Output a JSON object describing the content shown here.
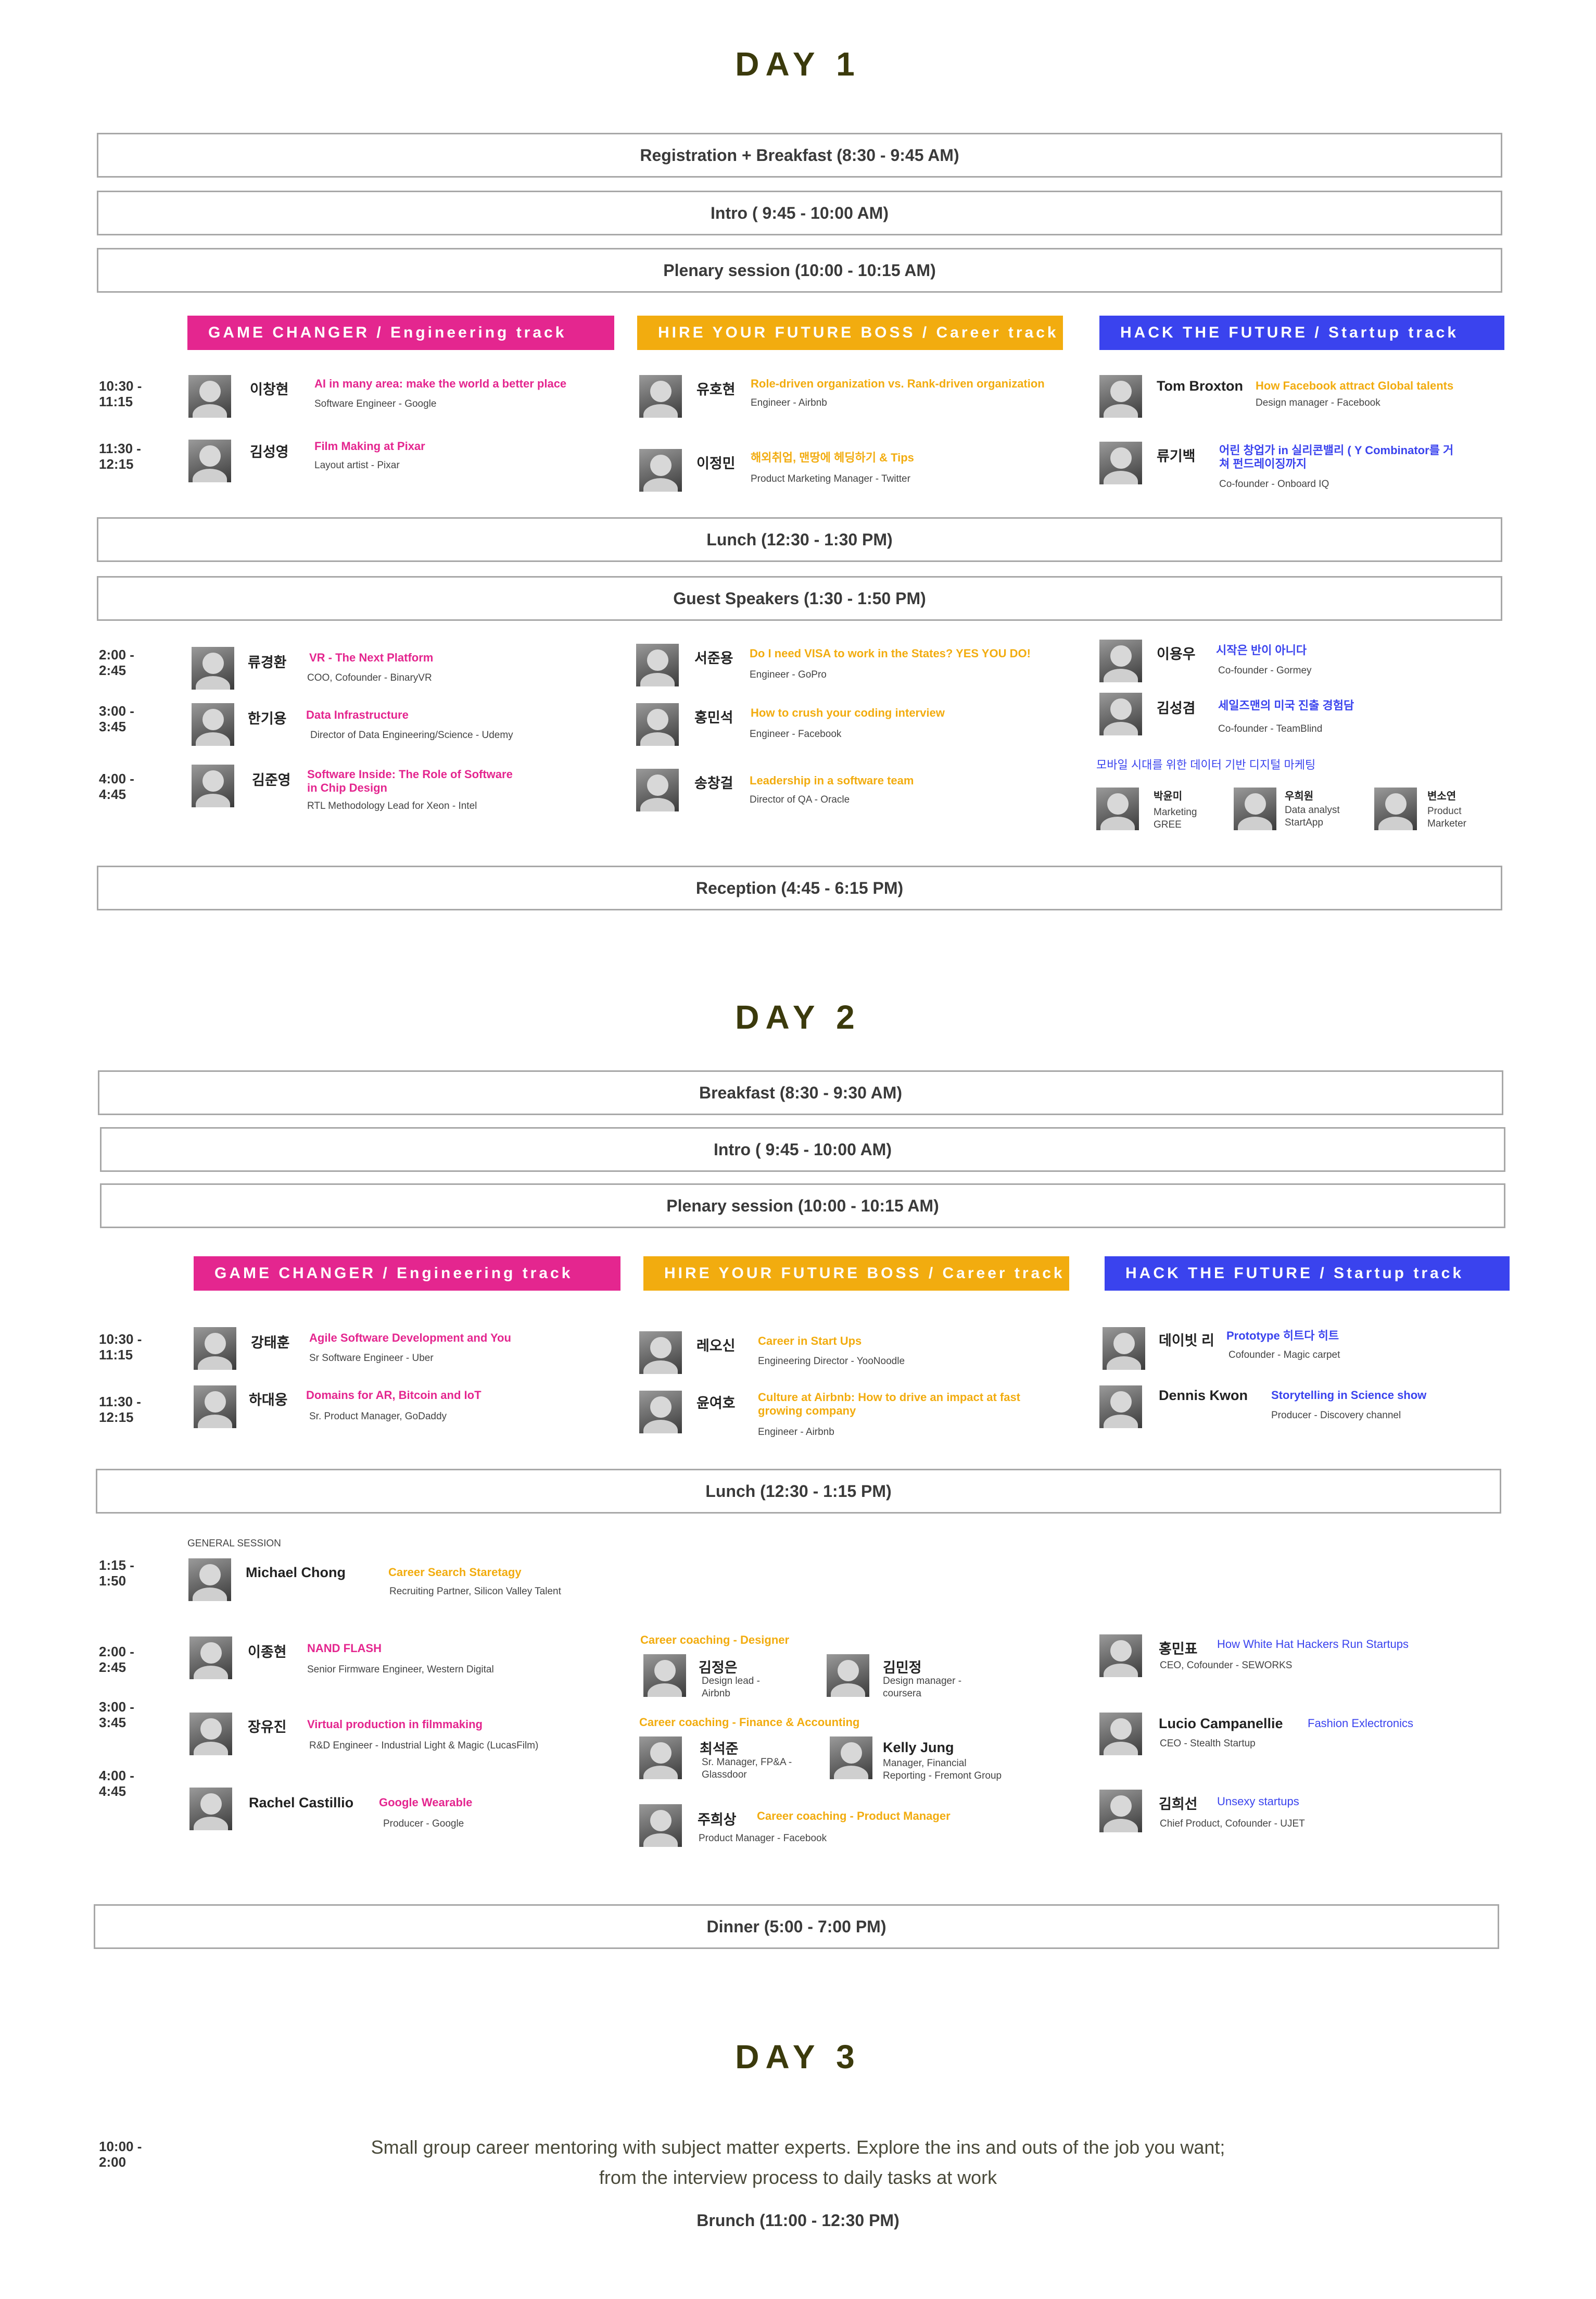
{
  "colors": {
    "engineering": "#e4268f",
    "career": "#f2ac0f",
    "startup": "#3a43ee",
    "title": "#3b3a0c",
    "border": "#a8a8a8"
  },
  "day1": {
    "title": "DAY 1",
    "registration": "Registration + Breakfast (8:30 - 9:45 AM)",
    "intro": "Intro ( 9:45 - 10:00 AM)",
    "plenary": "Plenary session (10:00 - 10:15 AM)",
    "tracks": [
      "GAME CHANGER / Engineering track",
      "HIRE YOUR FUTURE BOSS / Career track",
      "HACK THE FUTURE / Startup track"
    ],
    "times": {
      "t1": "10:30 -\n11:15",
      "t2": "11:30 -\n12:15",
      "t3": "2:00 -\n2:45",
      "t4": "3:00 -\n3:45",
      "t5": "4:00 -\n4:45"
    },
    "morning": [
      {
        "name": "이창현",
        "title": "AI in many area: make the world a better place",
        "role": "Software Engineer  - Google"
      },
      {
        "name": "김성영",
        "title": "Film Making at Pixar",
        "role": "Layout artist  - Pixar"
      },
      {
        "name": "유호현",
        "title": "Role-driven organization vs. Rank-driven organization",
        "role": "Engineer - Airbnb"
      },
      {
        "name": "이정민",
        "title": "해외취업, 맨땅에 헤딩하기 & Tips",
        "role": "Product Marketing Manager - Twitter"
      },
      {
        "name": "Tom Broxton",
        "title": "How Facebook attract Global talents",
        "role": "Design manager - Facebook"
      },
      {
        "name": "류기백",
        "title": "어린 창업가 in 실리콘밸리 ( Y Combinator를 거\n쳐 펀드레이징까지",
        "role": "Co-founder - Onboard IQ"
      }
    ],
    "lunch": "Lunch (12:30 - 1:30 PM)",
    "guest": "Guest Speakers (1:30 - 1:50 PM)",
    "afternoon": [
      {
        "name": "류경환",
        "title": "VR - The Next Platform",
        "role": "COO, Cofounder - BinaryVR"
      },
      {
        "name": "한기용",
        "title": "Data Infrastructure",
        "role": "Director of Data Engineering/Science - Udemy"
      },
      {
        "name": "김준영",
        "title": "Software Inside: The Role of Software\nin Chip Design",
        "role": "RTL Methodology Lead for Xeon - Intel"
      },
      {
        "name": "서준용",
        "title": "Do I need VISA to work in the States? YES YOU DO!",
        "role": "Engineer - GoPro"
      },
      {
        "name": "홍민석",
        "title": "How to crush your coding interview",
        "role": "Engineer - Facebook"
      },
      {
        "name": "송창걸",
        "title": "Leadership in a software team",
        "role": "Director of QA - Oracle"
      },
      {
        "name": "이용우",
        "title": "시작은 반이 아니다",
        "role": "Co-founder - Gormey"
      },
      {
        "name": "김성겸",
        "title": "세일즈맨의 미국 진출 경험담",
        "role": "Co-founder - TeamBlind"
      }
    ],
    "panel_title": "모바일 시대를 위한 데이터 기반 디지털 마케팅",
    "panel": [
      {
        "name": "박윤미",
        "role": "Marketing\nGREE"
      },
      {
        "name": "우희원",
        "role": "Data analyst\nStartApp"
      },
      {
        "name": "변소연",
        "role": "Product\nMarketer"
      }
    ],
    "reception": "Reception (4:45 - 6:15 PM)"
  },
  "day2": {
    "title": "DAY 2",
    "breakfast": "Breakfast (8:30 - 9:30 AM)",
    "intro": "Intro ( 9:45 - 10:00 AM)",
    "plenary": "Plenary session (10:00 - 10:15 AM)",
    "tracks": [
      "GAME CHANGER / Engineering track",
      "HIRE YOUR FUTURE BOSS / Career track",
      "HACK THE FUTURE / Startup track"
    ],
    "times": {
      "t1": "10:30 -\n11:15",
      "t2": "11:30 -\n12:15",
      "t3": "1:15 -\n1:50",
      "t4": "2:00 -\n2:45",
      "t5": "3:00 -\n3:45",
      "t6": "4:00 -\n4:45"
    },
    "morning": [
      {
        "name": "강태훈",
        "title": "Agile Software Development and You",
        "role": "Sr Software Engineer - Uber"
      },
      {
        "name": "하대웅",
        "title": "Domains for AR, Bitcoin and IoT",
        "role": "Sr. Product Manager, GoDaddy"
      },
      {
        "name": "레오신",
        "title": "Career in Start Ups",
        "role": "Engineering Director - YooNoodle"
      },
      {
        "name": "윤여호",
        "title": "Culture at Airbnb: How to drive an impact at fast\ngrowing company",
        "role": "Engineer - Airbnb"
      },
      {
        "name": "데이빗 리",
        "title": "Prototype 히트다 히트",
        "role": "Cofounder - Magic carpet"
      },
      {
        "name": "Dennis Kwon",
        "title": "Storytelling in Science show",
        "role": "Producer - Discovery channel"
      }
    ],
    "lunch": "Lunch (12:30 - 1:15 PM)",
    "general_label": "GENERAL SESSION",
    "general": {
      "name": "Michael Chong",
      "title": "Career Search  Staretagy",
      "role": "Recruiting Partner, Silicon Valley Talent"
    },
    "afternoon_eng": [
      {
        "name": "이종현",
        "title": "NAND FLASH",
        "role": "Senior Firmware Engineer, Western Digital"
      },
      {
        "name": "장유진",
        "title": "Virtual production in filmmaking",
        "role": "R&D Engineer - Industrial Light & Magic (LucasFilm)"
      },
      {
        "name": "Rachel Castillio",
        "title": "Google Wearable",
        "role": "Producer - Google"
      }
    ],
    "coaching_designer": "Career coaching - Designer",
    "coaching_finance": "Career coaching - Finance & Accounting",
    "coaching_pm": "Career coaching - Product Manager",
    "coaches": [
      {
        "name": "김정은",
        "role": "Design lead -\nAirbnb"
      },
      {
        "name": "김민정",
        "role": "Design manager -\ncoursera"
      },
      {
        "name": "최석준",
        "role": "Sr. Manager, FP&A -\nGlassdoor"
      },
      {
        "name": "Kelly Jung",
        "role": "Manager, Financial\nReporting - Fremont Group"
      },
      {
        "name": "주희상",
        "role": "Product Manager - Facebook"
      }
    ],
    "afternoon_startup": [
      {
        "name": "홍민표",
        "title": "How White Hat Hackers Run Startups",
        "role": "CEO, Cofounder - SEWORKS"
      },
      {
        "name": "Lucio Campanellie",
        "title": "Fashion Exlectronics",
        "role": "CEO - Stealth Startup"
      },
      {
        "name": "김희선",
        "title": "Unsexy startups",
        "role": "Chief Product, Cofounder - UJET"
      }
    ],
    "dinner": "Dinner (5:00 - 7:00 PM)"
  },
  "day3": {
    "title": "DAY 3",
    "time": "10:00 -\n2:00",
    "line1": "Small group career mentoring with subject matter experts. Explore the ins and outs of the job you want;",
    "line2": "from the interview process to daily tasks at work",
    "brunch": "Brunch (11:00 - 12:30 PM)"
  }
}
